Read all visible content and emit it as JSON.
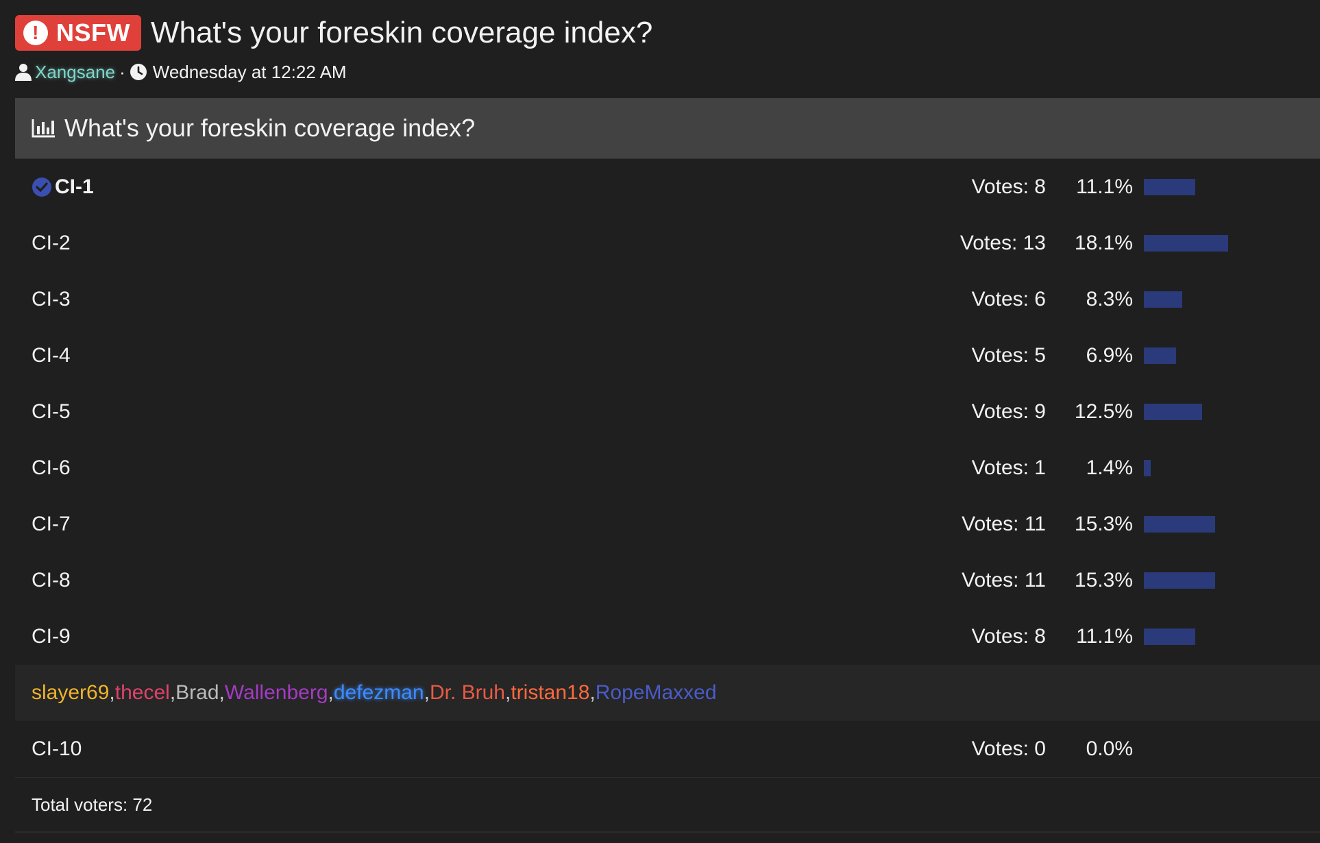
{
  "header": {
    "badge_label": "NSFW",
    "title": "What's your foreskin coverage index?"
  },
  "meta": {
    "author": "Xangsane",
    "separator": "·",
    "timestamp": "Wednesday at 12:22 AM"
  },
  "poll": {
    "title": "What's your foreskin coverage index?",
    "votes_prefix": "Votes: ",
    "options": [
      {
        "label": "CI-1",
        "votes": 8,
        "percent": "11.1%",
        "voted": true
      },
      {
        "label": "CI-2",
        "votes": 13,
        "percent": "18.1%",
        "voted": false
      },
      {
        "label": "CI-3",
        "votes": 6,
        "percent": "8.3%",
        "voted": false
      },
      {
        "label": "CI-4",
        "votes": 5,
        "percent": "6.9%",
        "voted": false
      },
      {
        "label": "CI-5",
        "votes": 9,
        "percent": "12.5%",
        "voted": false
      },
      {
        "label": "CI-6",
        "votes": 1,
        "percent": "1.4%",
        "voted": false
      },
      {
        "label": "CI-7",
        "votes": 11,
        "percent": "15.3%",
        "voted": false
      },
      {
        "label": "CI-8",
        "votes": 11,
        "percent": "15.3%",
        "voted": false
      },
      {
        "label": "CI-9",
        "votes": 8,
        "percent": "11.1%",
        "voted": false
      }
    ],
    "voters": [
      {
        "name": "slayer69",
        "color": "#f0b429"
      },
      {
        "name": "thecel",
        "color": "#e0436b"
      },
      {
        "name": "Brad",
        "color": "#bbbbbb"
      },
      {
        "name": "Wallenberg",
        "color": "#a43bc4"
      },
      {
        "name": "defezman",
        "color": "#3d8bff"
      },
      {
        "name": "Dr. Bruh",
        "color": "#e85a44"
      },
      {
        "name": "tristan18",
        "color": "#ff6a3d"
      },
      {
        "name": "RopeMaxxed",
        "color": "#4a5cc9"
      }
    ],
    "last_option": {
      "label": "CI-10",
      "votes": 0,
      "percent": "0.0%"
    },
    "total_voters": "Total voters: 72"
  },
  "colors": {
    "bar": "#2b3a7a",
    "badge": "#e0403a",
    "author": "#7fd6c9",
    "check": "#3a4fb0"
  },
  "icons": {
    "badge": "exclamation-icon",
    "author": "user-icon",
    "timestamp": "clock-icon",
    "poll": "bar-chart-icon",
    "voted": "check-circle-icon"
  }
}
